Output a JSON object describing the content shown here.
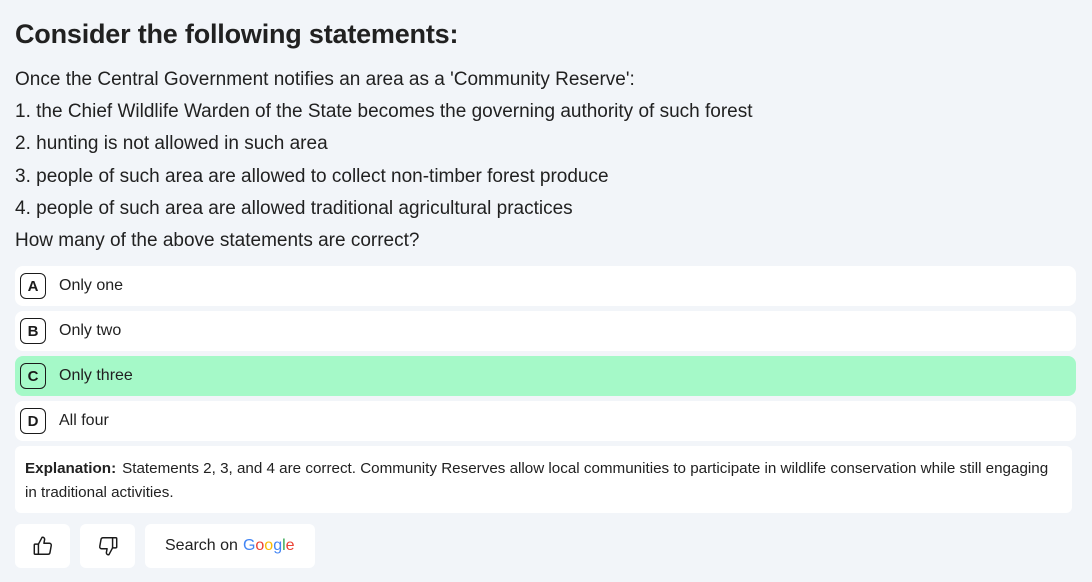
{
  "question": {
    "title": "Consider the following statements:",
    "lines": [
      "Once the Central Government notifies an area as a 'Community Reserve':",
      "1. the Chief Wildlife Warden of the State becomes the governing authority of such forest",
      "2. hunting is not allowed in such area",
      "3. people of such area are allowed to collect non-timber forest produce",
      "4. people of such area are allowed traditional agricultural practices",
      "How many of the above statements are correct?"
    ]
  },
  "options": [
    {
      "letter": "A",
      "text": "Only one",
      "correct": false
    },
    {
      "letter": "B",
      "text": "Only two",
      "correct": false
    },
    {
      "letter": "C",
      "text": "Only three",
      "correct": true
    },
    {
      "letter": "D",
      "text": "All four",
      "correct": false
    }
  ],
  "colors": {
    "correct_bg": "#a5f9c8",
    "page_bg": "#f2f5f9"
  },
  "explanation": {
    "label": "Explanation:",
    "text": "Statements 2, 3, and 4 are correct. Community Reserves allow local communities to participate in wildlife conservation while still engaging in traditional activities."
  },
  "actions": {
    "like_icon": "thumbs-up-icon",
    "dislike_icon": "thumbs-down-icon",
    "search_label": "Search on",
    "search_brand": {
      "letters": [
        "G",
        "o",
        "o",
        "g",
        "l",
        "e"
      ],
      "colors": [
        "#4285f4",
        "#ea4335",
        "#fbbc05",
        "#4285f4",
        "#34a853",
        "#ea4335"
      ]
    }
  }
}
